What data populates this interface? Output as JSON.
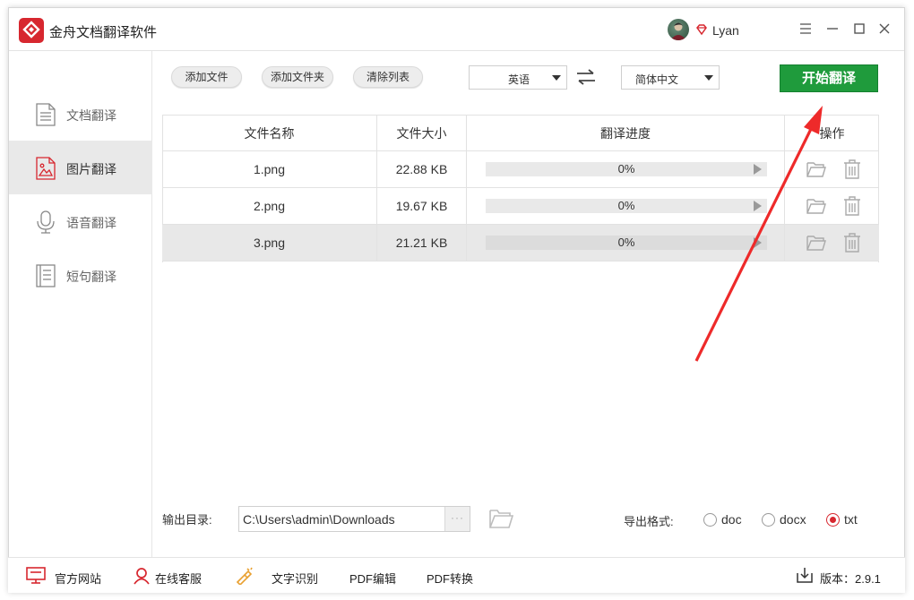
{
  "app": {
    "title": "金舟文档翻译软件",
    "username": "Lyan"
  },
  "sidebar": {
    "items": [
      {
        "label": "文档翻译",
        "icon": "document-icon",
        "active": false
      },
      {
        "label": "图片翻译",
        "icon": "image-icon",
        "active": true
      },
      {
        "label": "语音翻译",
        "icon": "microphone-icon",
        "active": false
      },
      {
        "label": "短句翻译",
        "icon": "text-lines-icon",
        "active": false
      }
    ]
  },
  "toolbar": {
    "add_file": "添加文件",
    "add_folder": "添加文件夹",
    "clear_list": "清除列表",
    "source_lang": "英语",
    "target_lang": "简体中文",
    "start": "开始翻译"
  },
  "table": {
    "headers": [
      "文件名称",
      "文件大小",
      "翻译进度",
      "操作"
    ],
    "rows": [
      {
        "name": "1.png",
        "size": "22.88 KB",
        "progress": "0%",
        "progress_value": 0,
        "selected": false
      },
      {
        "name": "2.png",
        "size": "19.67 KB",
        "progress": "0%",
        "progress_value": 0,
        "selected": false
      },
      {
        "name": "3.png",
        "size": "21.21 KB",
        "progress": "0%",
        "progress_value": 0,
        "selected": true
      }
    ]
  },
  "output": {
    "label": "输出目录:",
    "path": "C:\\Users\\admin\\Downloads",
    "browse": "···",
    "format_label": "导出格式:",
    "formats": [
      {
        "label": "doc",
        "selected": false
      },
      {
        "label": "docx",
        "selected": false
      },
      {
        "label": "txt",
        "selected": true
      }
    ]
  },
  "footer": {
    "website": "官方网站",
    "support": "在线客服",
    "ocr": "文字识别",
    "pdf_edit": "PDF编辑",
    "pdf_convert": "PDF转换",
    "version": "版本：2.9.1"
  },
  "colors": {
    "accent_red": "#d7272f",
    "start_green": "#1f9b3c",
    "annotation_arrow": "#ee2a2a"
  }
}
